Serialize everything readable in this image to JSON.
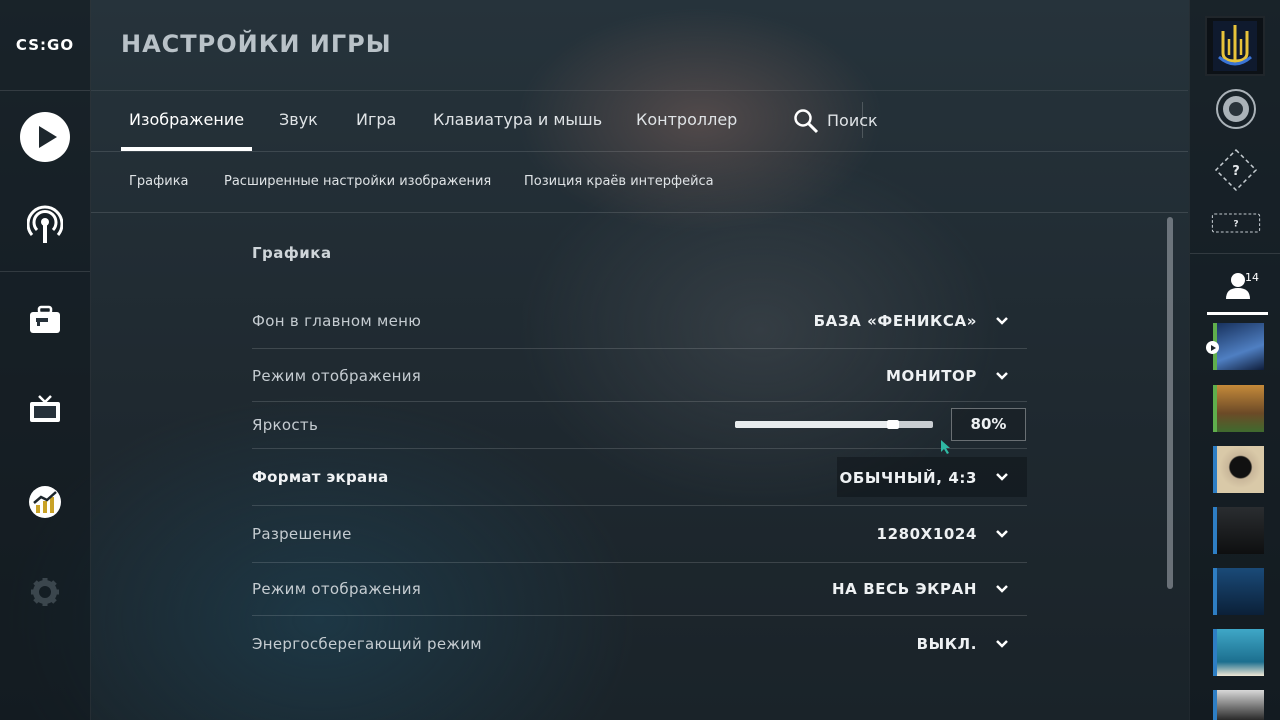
{
  "app": {
    "logo_text": "CS:GO",
    "page_title": "НАСТРОЙКИ ИГРЫ"
  },
  "left_nav": [
    {
      "name": "play",
      "icon": "play-icon"
    },
    {
      "name": "broadcast",
      "icon": "antenna-icon"
    },
    {
      "name": "inventory",
      "icon": "briefcase-icon"
    },
    {
      "name": "watch",
      "icon": "tv-icon"
    },
    {
      "name": "stats",
      "icon": "stats-chart-icon"
    },
    {
      "name": "settings",
      "icon": "gear-icon"
    }
  ],
  "tabs": [
    {
      "label": "Изображение",
      "active": true
    },
    {
      "label": "Звук"
    },
    {
      "label": "Игра"
    },
    {
      "label": "Клавиатура и мышь"
    },
    {
      "label": "Контроллер"
    }
  ],
  "search": {
    "label": "Поиск",
    "icon": "search-icon"
  },
  "subtabs": [
    {
      "label": "Графика"
    },
    {
      "label": "Расширенные настройки изображения"
    },
    {
      "label": "Позиция краёв интерфейса"
    }
  ],
  "section": {
    "title": "Графика"
  },
  "settings": {
    "main_menu_bg": {
      "label": "Фон в главном меню",
      "value": "БАЗА «ФЕНИКСА»"
    },
    "display_mode_1": {
      "label": "Режим отображения",
      "value": "МОНИТОР"
    },
    "brightness": {
      "label": "Яркость",
      "value": "80%",
      "fraction": 0.8
    },
    "aspect_ratio": {
      "label": "Формат экрана",
      "value": "ОБЫЧНЫЙ, 4:3"
    },
    "resolution": {
      "label": "Разрешение",
      "value": "1280X1024"
    },
    "display_mode_2": {
      "label": "Режим отображения",
      "value": "НА ВЕСЬ ЭКРАН"
    },
    "power_saving": {
      "label": "Энергосберегающий режим",
      "value": "ВЫКЛ."
    }
  },
  "right_bar": {
    "rank_icons": [
      "rank-emblem-icon",
      "unknown-rank-diamond-icon",
      "unknown-rank-rectangle-icon"
    ],
    "friends_count": "14",
    "friend_statuses": [
      "in-game",
      "online",
      "away",
      "away",
      "away",
      "away",
      "away"
    ]
  },
  "colors": {
    "accent": "#ffffff",
    "online_green": "#5fae4c",
    "away_blue": "#2e7ec4"
  }
}
